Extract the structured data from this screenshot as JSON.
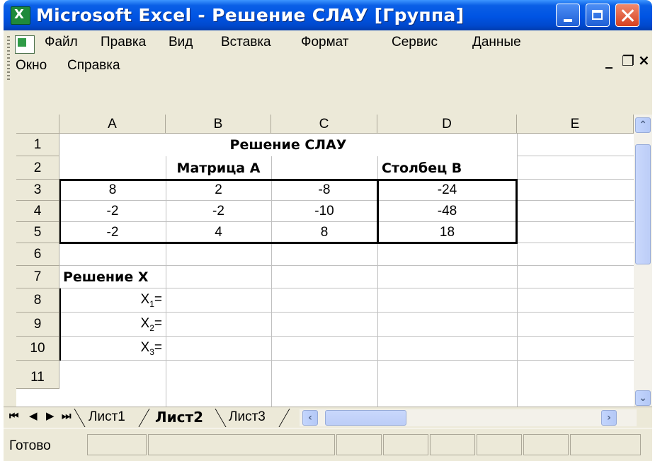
{
  "window": {
    "title": "Microsoft Excel - Решение СЛАУ  [Группа]"
  },
  "menu": {
    "items": [
      "Файл",
      "Правка",
      "Вид",
      "Вставка",
      "Формат",
      "Сервис",
      "Данные",
      "Окно",
      "Справка"
    ],
    "mdi": {
      "minimize": "_",
      "restore": "❐",
      "close": "×"
    }
  },
  "columns": [
    "A",
    "B",
    "C",
    "D",
    "E"
  ],
  "rows": [
    "1",
    "2",
    "3",
    "4",
    "5",
    "6",
    "7",
    "8",
    "9",
    "10",
    "11"
  ],
  "cells": {
    "title": "Решение СЛАУ",
    "matrix_header": "Матрица А",
    "column_header": "Столбец В",
    "matrix": [
      [
        "8",
        "2",
        "-8",
        "-24"
      ],
      [
        "-2",
        "-2",
        "-10",
        "-48"
      ],
      [
        "-2",
        "4",
        "8",
        "18"
      ]
    ],
    "solution_label": "Решение Х",
    "x_labels": [
      "X",
      "X",
      "X"
    ],
    "x_subscripts": [
      "1",
      "2",
      "3"
    ],
    "eq": "="
  },
  "sheet_tabs": [
    "Лист1",
    "Лист2",
    "Лист3"
  ],
  "active_tab": "Лист2",
  "status": "Готово",
  "colors": {
    "titlebar": "#0054e3",
    "chrome": "#ece9d8",
    "grid_line": "#c0c0c0"
  }
}
